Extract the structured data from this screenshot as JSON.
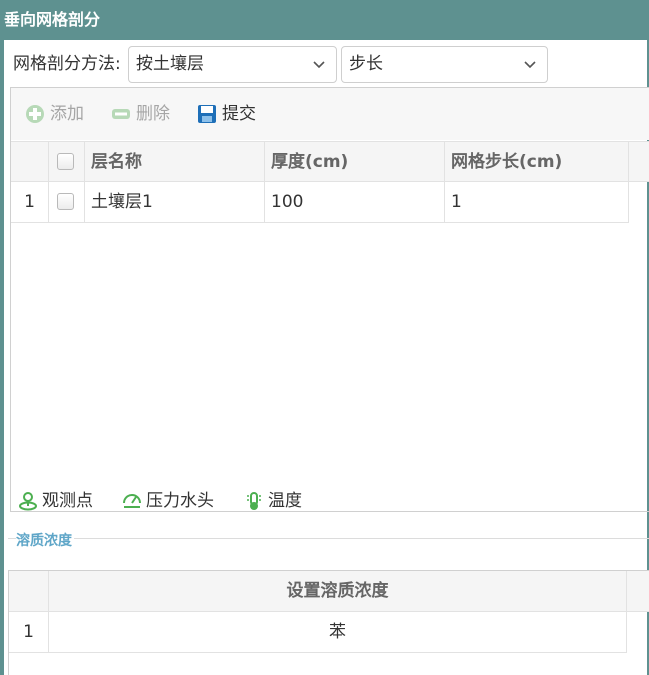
{
  "title": "垂向网格剖分",
  "method": {
    "label": "网格剖分方法:",
    "select1": "按土壤层",
    "select2": "步长"
  },
  "toolbar": {
    "add": "添加",
    "delete": "删除",
    "submit": "提交"
  },
  "grid": {
    "columns": [
      "层名称",
      "厚度(cm)",
      "网格步长(cm)"
    ],
    "rows": [
      {
        "index": "1",
        "name": "土壤层1",
        "thickness": "100",
        "step": "1"
      }
    ]
  },
  "observe": {
    "point": "观测点",
    "pressure": "压力水头",
    "temperature": "温度"
  },
  "solute": {
    "legend": "溶质浓度",
    "column": "设置溶质浓度",
    "rows": [
      {
        "index": "1",
        "value": "苯"
      }
    ]
  },
  "colors": {
    "titlebar": "#5e9190",
    "green_icon": "#4caf50",
    "blue_icon": "#1e6fb8",
    "legend": "#5fa6c8"
  }
}
